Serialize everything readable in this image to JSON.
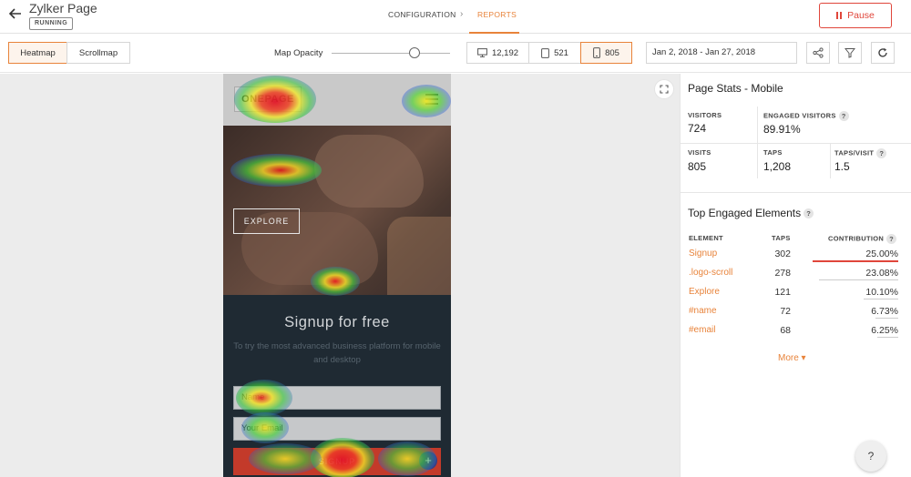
{
  "header": {
    "page_title": "Zylker Page",
    "status": "RUNNING",
    "tabs": [
      {
        "label": "CONFIGURATION"
      },
      {
        "label": "REPORTS"
      }
    ],
    "pause_label": "Pause"
  },
  "toolbar": {
    "modes": [
      {
        "label": "Heatmap"
      },
      {
        "label": "Scrollmap"
      }
    ],
    "opacity_label": "Map Opacity",
    "opacity_value": 0.7,
    "devices": [
      {
        "icon": "desktop-icon",
        "count": "12,192"
      },
      {
        "icon": "tablet-icon",
        "count": "521"
      },
      {
        "icon": "mobile-icon",
        "count": "805"
      }
    ],
    "date_range": "Jan 2, 2018 - Jan 27, 2018"
  },
  "preview": {
    "logo": "ONEPAGE",
    "hero_button": "EXPLORE",
    "signup_title": "Signup for free",
    "signup_sub": "To try the most advanced business platform for mobile and desktop",
    "name_input": "Name",
    "email_input": "Your Email",
    "signup_button": "SIGNUP",
    "plus": "+"
  },
  "stats": {
    "title": "Page Stats - Mobile",
    "visitors_label": "VISITORS",
    "visitors": "724",
    "engaged_label": "ENGAGED VISITORS",
    "engaged": "89.91%",
    "visits_label": "VISITS",
    "visits": "805",
    "taps_label": "TAPS",
    "taps": "1,208",
    "tpv_label": "TAPS/VISIT",
    "tpv": "1.5",
    "help": "?"
  },
  "elements": {
    "title": "Top Engaged Elements",
    "col_element": "ELEMENT",
    "col_taps": "TAPS",
    "col_contrib": "CONTRIBUTION",
    "rows": [
      {
        "name": "Signup",
        "taps": "302",
        "contribution": "25.00%",
        "share": 25.0
      },
      {
        "name": ".logo-scroll",
        "taps": "278",
        "contribution": "23.08%",
        "share": 23.08
      },
      {
        "name": "Explore",
        "taps": "121",
        "contribution": "10.10%",
        "share": 10.1
      },
      {
        "name": "#name",
        "taps": "72",
        "contribution": "6.73%",
        "share": 6.73
      },
      {
        "name": "#email",
        "taps": "68",
        "contribution": "6.25%",
        "share": 6.25
      }
    ],
    "more_label": "More ▾"
  },
  "help_fab": "?"
}
